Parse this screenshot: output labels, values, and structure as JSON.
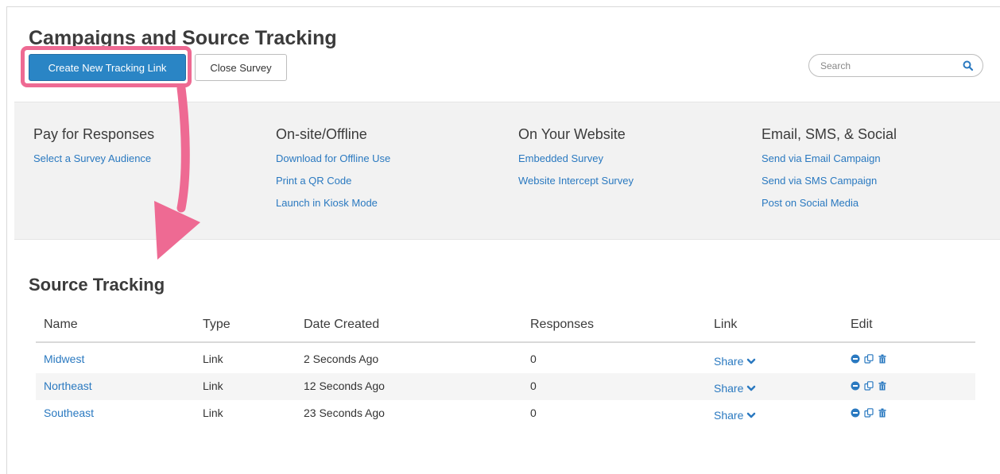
{
  "page": {
    "title": "Campaigns and Source Tracking",
    "create_button": "Create New Tracking Link",
    "close_button": "Close Survey",
    "search_placeholder": "Search"
  },
  "distribution": {
    "columns": [
      {
        "heading": "Pay for Responses",
        "links": [
          "Select a Survey Audience"
        ]
      },
      {
        "heading": "On-site/Offline",
        "links": [
          "Download for Offline Use",
          "Print a QR Code",
          "Launch in Kiosk Mode"
        ]
      },
      {
        "heading": "On Your Website",
        "links": [
          "Embedded Survey",
          "Website Intercept Survey"
        ]
      },
      {
        "heading": "Email, SMS, & Social",
        "links": [
          "Send via Email Campaign",
          "Send via SMS Campaign",
          "Post on Social Media"
        ]
      }
    ]
  },
  "tracking": {
    "title": "Source Tracking",
    "headers": [
      "Name",
      "Type",
      "Date Created",
      "Responses",
      "Link",
      "Edit"
    ],
    "rows": [
      {
        "name": "Midwest",
        "type": "Link",
        "date": "2 Seconds Ago",
        "responses": "0",
        "link": "Share"
      },
      {
        "name": "Northeast",
        "type": "Link",
        "date": "12 Seconds Ago",
        "responses": "0",
        "link": "Share"
      },
      {
        "name": "Southeast",
        "type": "Link",
        "date": "23 Seconds Ago",
        "responses": "0",
        "link": "Share"
      }
    ]
  },
  "icons": {
    "search": "search-icon",
    "share_chevron": "chevron-down-icon",
    "edit": [
      "disable-icon",
      "copy-icon",
      "trash-icon"
    ]
  },
  "colors": {
    "primary": "#2a85c5",
    "link": "#2a79c0",
    "highlight": "#ee6a93",
    "panel_bg": "#f2f2f2"
  }
}
